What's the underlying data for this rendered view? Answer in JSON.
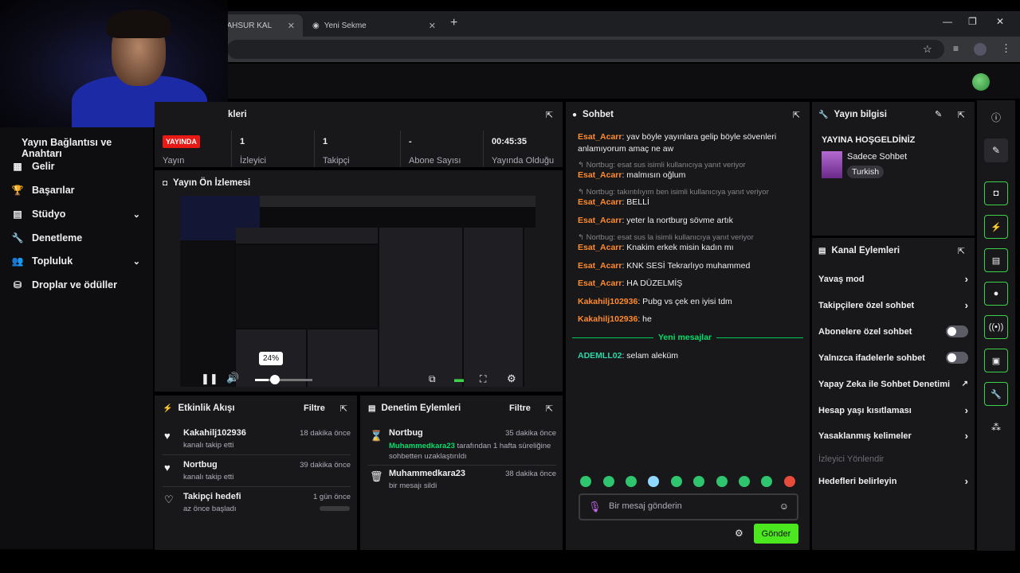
{
  "browser": {
    "tab1_title": "DA MAHSUR KAL",
    "tab2_title": "Yeni Sekme",
    "tab_close": "✕",
    "new_tab": "+",
    "win_min": "—",
    "win_max": "❐",
    "win_close": "✕"
  },
  "sidebar": {
    "header": "Yayın Bağlantısı ve Anahtarı",
    "items": [
      {
        "label": "Gelir",
        "icon": "▦"
      },
      {
        "label": "Başarılar",
        "icon": "🏆"
      },
      {
        "label": "Stüdyo",
        "icon": "▤",
        "chevron": "⌄"
      },
      {
        "label": "Denetleme",
        "icon": "🔧"
      },
      {
        "label": "Topluluk",
        "icon": "👥",
        "chevron": "⌄"
      },
      {
        "label": "Droplar ve ödüller",
        "icon": "⛁"
      }
    ]
  },
  "stats": {
    "title_partial": "kleri",
    "live_badge": "YAYINDA",
    "broadcast_label": "Yayın",
    "cols": [
      {
        "value": "1",
        "label": "İzleyici"
      },
      {
        "value": "1",
        "label": "Takipçi"
      },
      {
        "value": "-",
        "label": "Abone Sayısı"
      },
      {
        "value": "00:45:35",
        "label": "Yayında Olduğu"
      }
    ]
  },
  "preview": {
    "title": "Yayın Ön İzlemesi",
    "volume_tooltip": "24%",
    "volume_level": 0.24
  },
  "activity": {
    "title": "Etkinlik Akışı",
    "filter": "Filtre",
    "events": [
      {
        "name": "Kakahilj102936",
        "time": "18 dakika önce",
        "sub": "kanalı takip etti"
      },
      {
        "name": "Nortbug",
        "time": "39 dakika önce",
        "sub": "kanalı takip etti"
      },
      {
        "name": "Takipçi hedefi",
        "time": "1 gün önce",
        "sub": "az önce başladı"
      }
    ]
  },
  "moderation": {
    "title": "Denetim Eylemleri",
    "filter": "Filtre",
    "events": [
      {
        "name": "Nortbug",
        "time": "35 dakika önce",
        "actor": "Muhammedkara23",
        "sub": " tarafından 1 hafta süreliğine sohbetten uzaklaştırıldı"
      },
      {
        "name": "Muhammedkara23",
        "time": "38 dakika önce",
        "sub": "bir mesajı sildi"
      }
    ]
  },
  "chat": {
    "title": "Sohbet",
    "messages": [
      {
        "user": "Esat_Acarr",
        "text": ": yav böyle yayınlara gelip böyle sövenleri anlamıyorum amaç ne aw"
      },
      {
        "reply": "↰ Nortbug: esat sus isimli kullanıcıya yanıt veriyor"
      },
      {
        "user": "Esat_Acarr",
        "text": ": malmısın oğlum"
      },
      {
        "reply": "↰ Nortbug: takıntılıyım ben isimli kullanıcıya yanıt veriyor"
      },
      {
        "user": "Esat_Acarr",
        "text": ": BELLİ"
      },
      {
        "user": "Esat_Acarr",
        "text": ": yeter la nortburg sövme artık"
      },
      {
        "reply": "↰ Nortbug: esat sus la isimli kullanıcıya yanıt veriyor"
      },
      {
        "user": "Esat_Acarr",
        "text": ": Knakim erkek misin kadın mı"
      },
      {
        "user": "Esat_Acarr",
        "text": ": KNK SESİ Tekrarlıyo muhammed"
      },
      {
        "user": "Esat_Acarr",
        "text": ": HA DÜZELMİŞ"
      },
      {
        "user": "Kakahilj102936",
        "text": ": Pubg vs çek en iyisi tdm"
      },
      {
        "user": "Kakahilj102936",
        "text": ": he"
      },
      {
        "user": "ADEMLL02",
        "text": ": selam aleküm"
      }
    ],
    "new_messages_label": "Yeni mesajlar",
    "input_placeholder": "Bir mesaj gönderin",
    "send_label": "Gönder",
    "colors": {
      "orange": "#ff8a2b",
      "green": "#00e06c",
      "teal": "#2ad6a8"
    }
  },
  "info": {
    "title": "Yayın bilgisi",
    "stream_title": "YAYINA HOŞGELDİNİZ",
    "category": "Sadece Sohbet",
    "language_tag": "Turkish"
  },
  "actions": {
    "title": "Kanal Eylemleri",
    "items": [
      {
        "label": "Yavaş mod",
        "control": "arrow"
      },
      {
        "label": "Takipçilere özel sohbet",
        "control": "arrow"
      },
      {
        "label": "Abonelere özel sohbet",
        "control": "toggle"
      },
      {
        "label": "Yalnızca ifadelerle sohbet",
        "control": "toggle"
      },
      {
        "label": "Yapay Zeka ile Sohbet Denetimi",
        "control": "external"
      },
      {
        "label": "Hesap yaşı kısıtlaması",
        "control": "arrow"
      },
      {
        "label": "Yasaklanmış kelimeler",
        "control": "arrow"
      },
      {
        "label": "İzleyici Yönlendir",
        "control": "none",
        "disabled": true
      },
      {
        "label": "Hedefleri belirleyin",
        "control": "arrow"
      }
    ]
  },
  "accent": "#3bd24a"
}
